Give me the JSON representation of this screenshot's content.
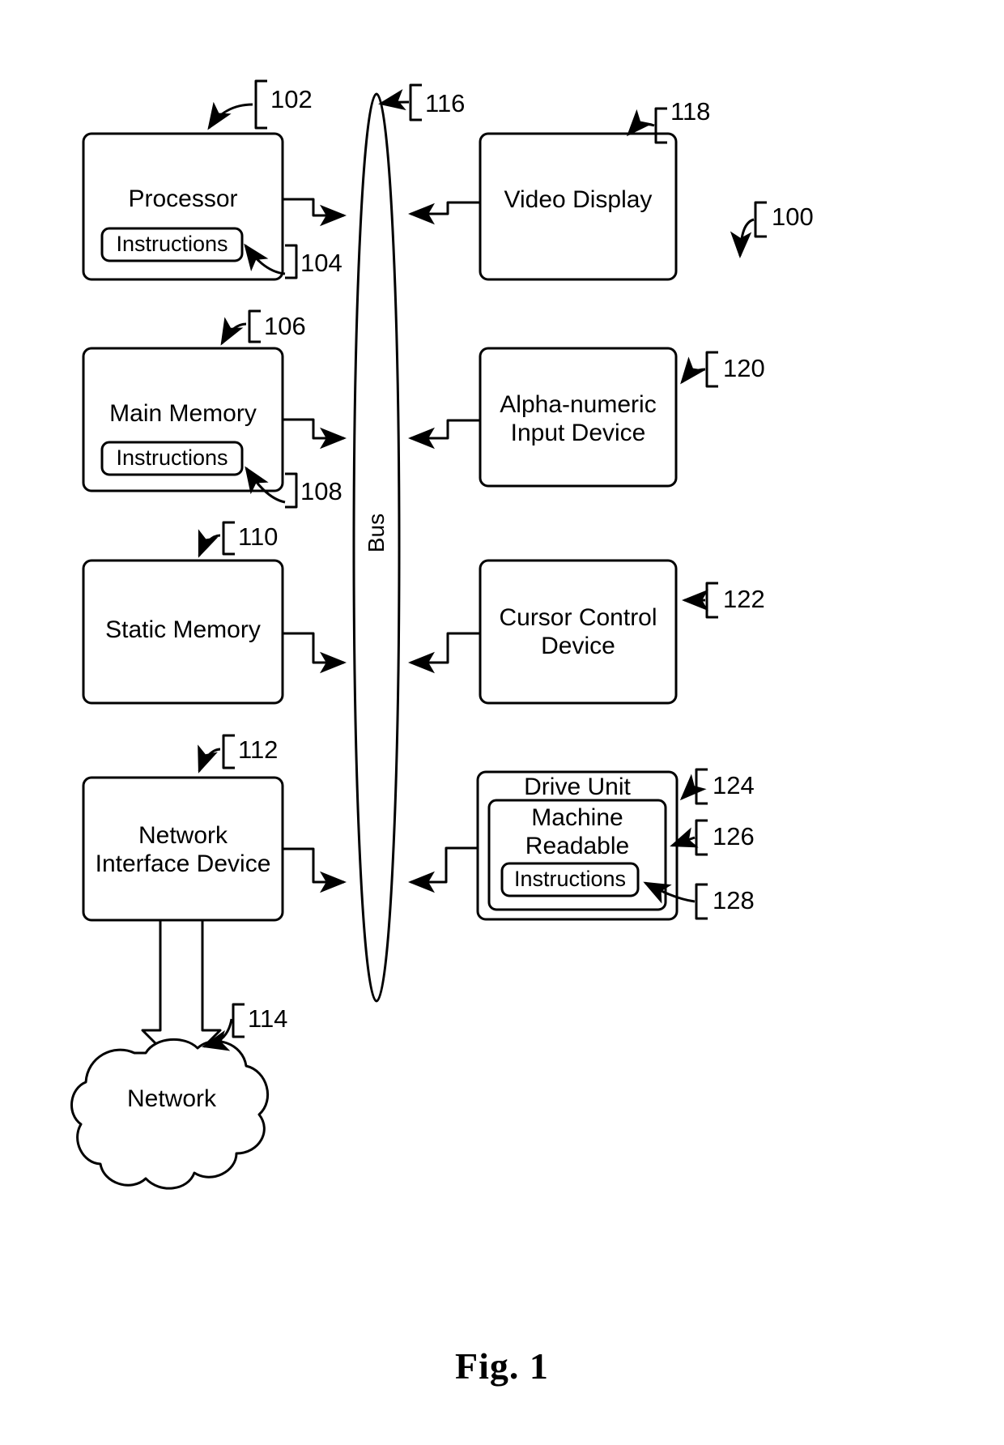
{
  "figure": {
    "caption": "Fig. 1",
    "system_ref": "100"
  },
  "blocks": {
    "processor": {
      "label": "Processor",
      "ref": "102"
    },
    "processor_instructions": {
      "label": "Instructions",
      "ref": "104"
    },
    "main_memory": {
      "label": "Main Memory",
      "ref": "106"
    },
    "main_memory_instructions": {
      "label": "Instructions",
      "ref": "108"
    },
    "static_memory": {
      "label": "Static Memory",
      "ref": "110"
    },
    "network_interface_device": {
      "label": "Network\nInterface Device",
      "ref": "112"
    },
    "network": {
      "label": "Network",
      "ref": "114"
    },
    "bus": {
      "label": "Bus",
      "ref": "116"
    },
    "video_display": {
      "label": "Video Display",
      "ref": "118"
    },
    "alpha_numeric_input_device": {
      "label": "Alpha-numeric\nInput Device",
      "ref": "120"
    },
    "cursor_control_device": {
      "label": "Cursor Control\nDevice",
      "ref": "122"
    },
    "drive_unit": {
      "label": "Drive Unit",
      "ref": "124"
    },
    "machine_readable": {
      "label": "Machine\nReadable",
      "ref": "126"
    },
    "drive_instructions": {
      "label": "Instructions",
      "ref": "128"
    }
  },
  "style": {
    "stroke": "#000000",
    "fill": "#ffffff",
    "line_width": 3
  }
}
